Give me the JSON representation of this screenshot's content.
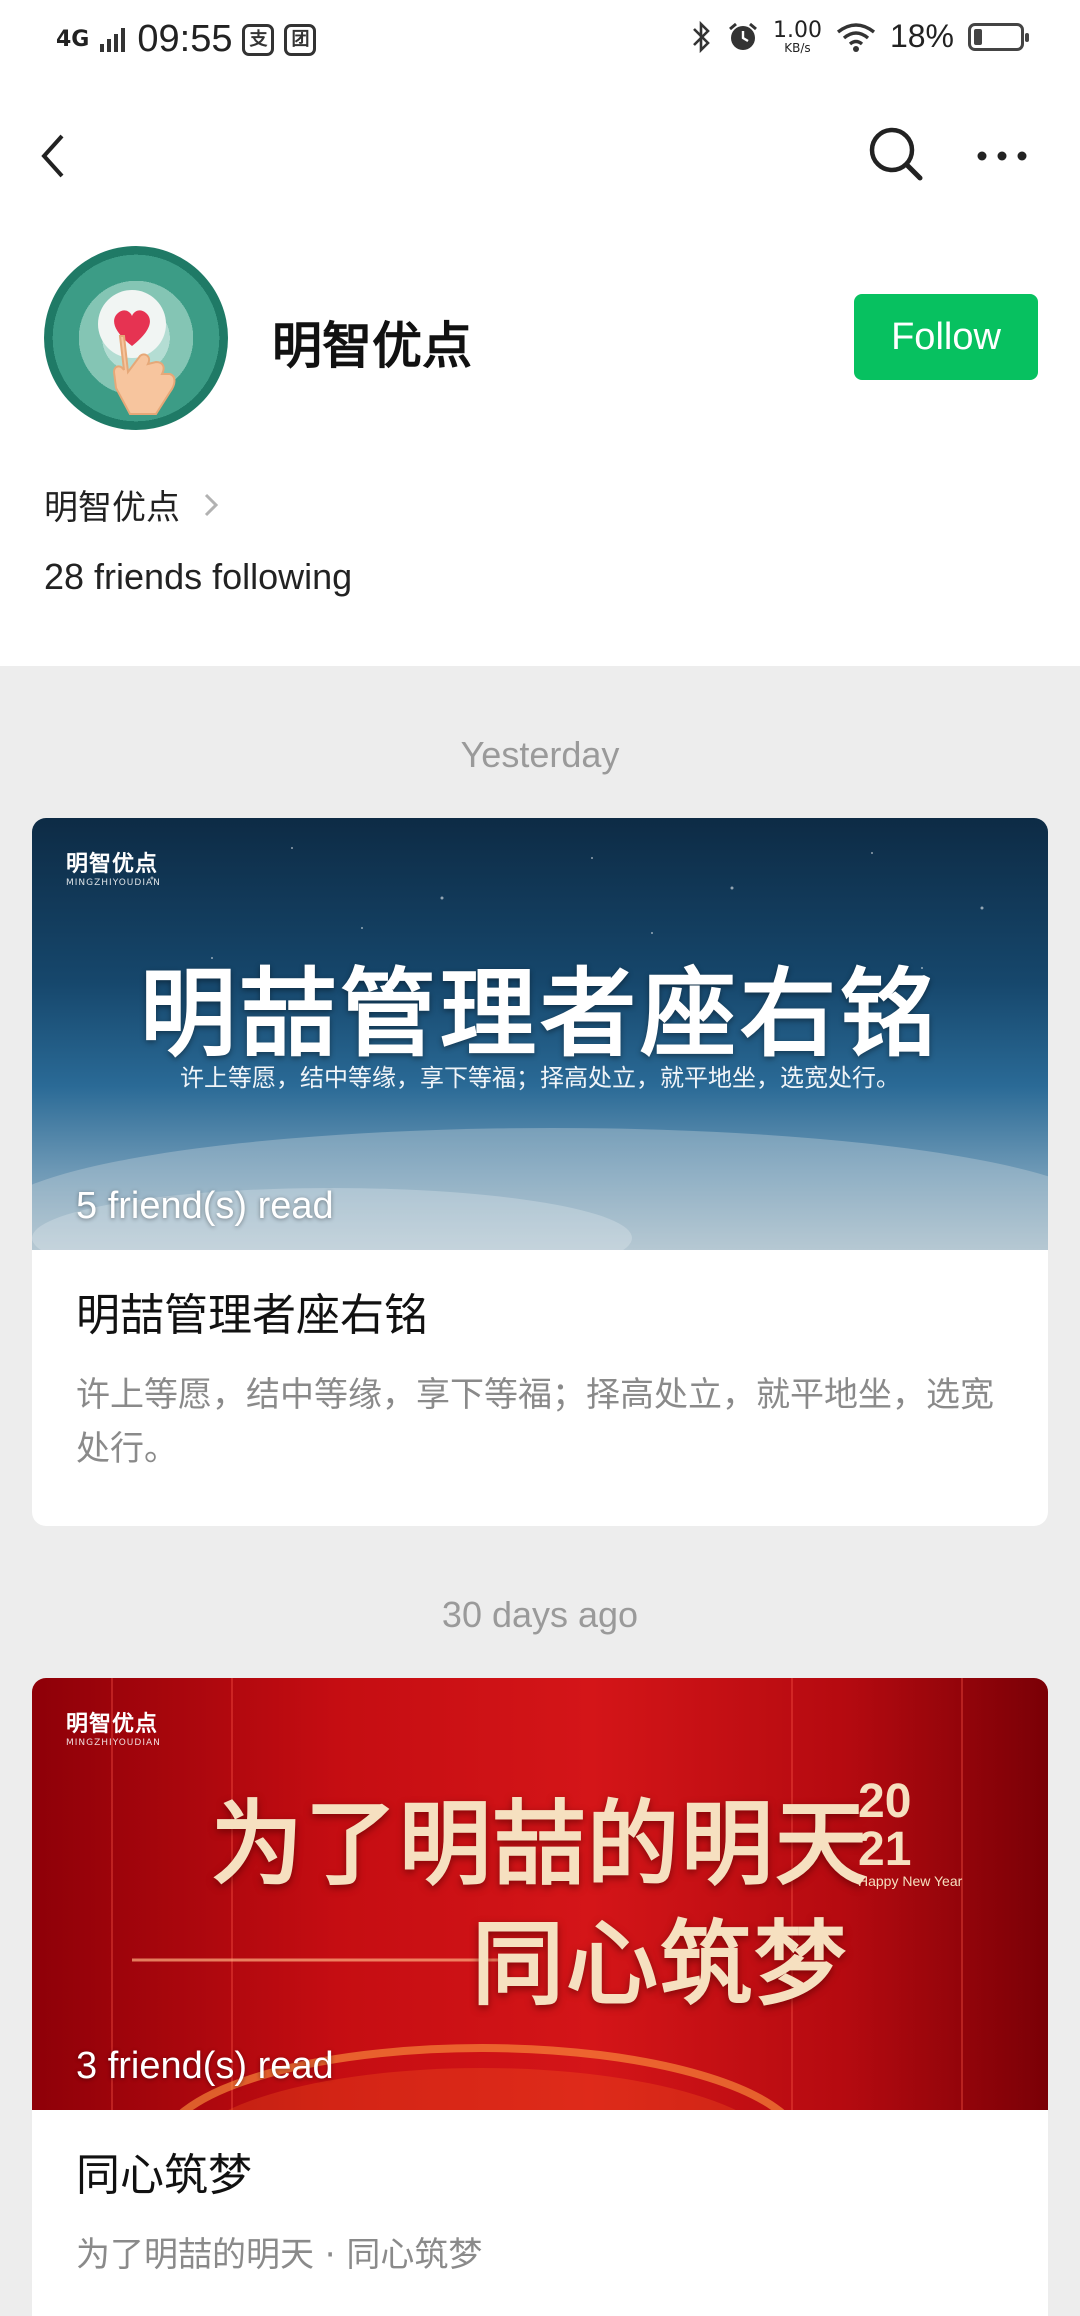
{
  "status_bar": {
    "network": "4G",
    "time": "09:55",
    "app_icon_1": "支",
    "app_icon_2": "团",
    "speed_value": "1.00",
    "speed_unit": "KB/s",
    "battery_percent": "18%",
    "battery_level": 0.18,
    "icons": [
      "bluetooth-icon",
      "alarm-icon",
      "wifi-icon",
      "battery-icon"
    ]
  },
  "nav": {
    "icons": [
      "back-icon",
      "search-icon",
      "more-icon"
    ]
  },
  "account": {
    "name": "明智优点",
    "follow_label": "Follow",
    "sub_label": "明智优点",
    "friends_following": "28 friends following",
    "accent_color": "#07c160"
  },
  "feed": [
    {
      "date_label": "Yesterday",
      "cover": {
        "brand": "明智优点",
        "brand_sub": "MINGZHIYOUDIAN",
        "title": "明喆管理者座右铭",
        "subtitle": "许上等愿，结中等缘，享下等福；择高处立，就平地坐，选宽处行。"
      },
      "read_count": "5 friend(s) read",
      "title": "明喆管理者座右铭",
      "description": "许上等愿，结中等缘，享下等福；择高处立，就平地坐，选宽处行。"
    },
    {
      "date_label": "30 days ago",
      "cover": {
        "brand": "明智优点",
        "brand_sub": "MINGZHIYOUDIAN",
        "title_line1": "为了明喆的明天",
        "title_line2": "同心筑梦",
        "year_top": "20",
        "year_bottom": "21",
        "year_caption": "Happy New Year"
      },
      "read_count": "3 friend(s) read",
      "title": "同心筑梦",
      "description": "为了明喆的明天 · 同心筑梦"
    }
  ]
}
